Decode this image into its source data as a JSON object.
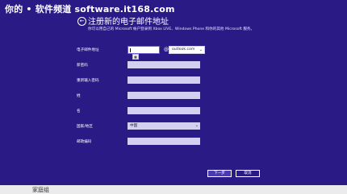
{
  "watermark": "你的 • 软件频道 software.it168.com",
  "header": {
    "back_glyph": "←",
    "title": "注册新的电子邮件地址"
  },
  "intro_text": "你可以用自己的 Microsoft 帐户登录到 Xbox LIVE、Windows Phone 和你的其他 Microsoft 服务。",
  "form": {
    "email": {
      "label": "电子邮件地址",
      "value": "",
      "at": "@",
      "domain": "outlook.com",
      "suggestion_glyph": "▦"
    },
    "password_label": "新密码",
    "confirm_label": "重新输入密码",
    "last_name_label": "姓",
    "first_name_label": "名",
    "country": {
      "label": "国家/地区",
      "value": "中国"
    },
    "zip_label": "邮政编码"
  },
  "buttons": {
    "next": "下一步",
    "cancel": "取消"
  },
  "taskbar": {
    "label": "家庭组"
  },
  "colors": {
    "background": "#2a1a86",
    "field": "#d3cff0",
    "taskbar": "#ebebeb"
  }
}
